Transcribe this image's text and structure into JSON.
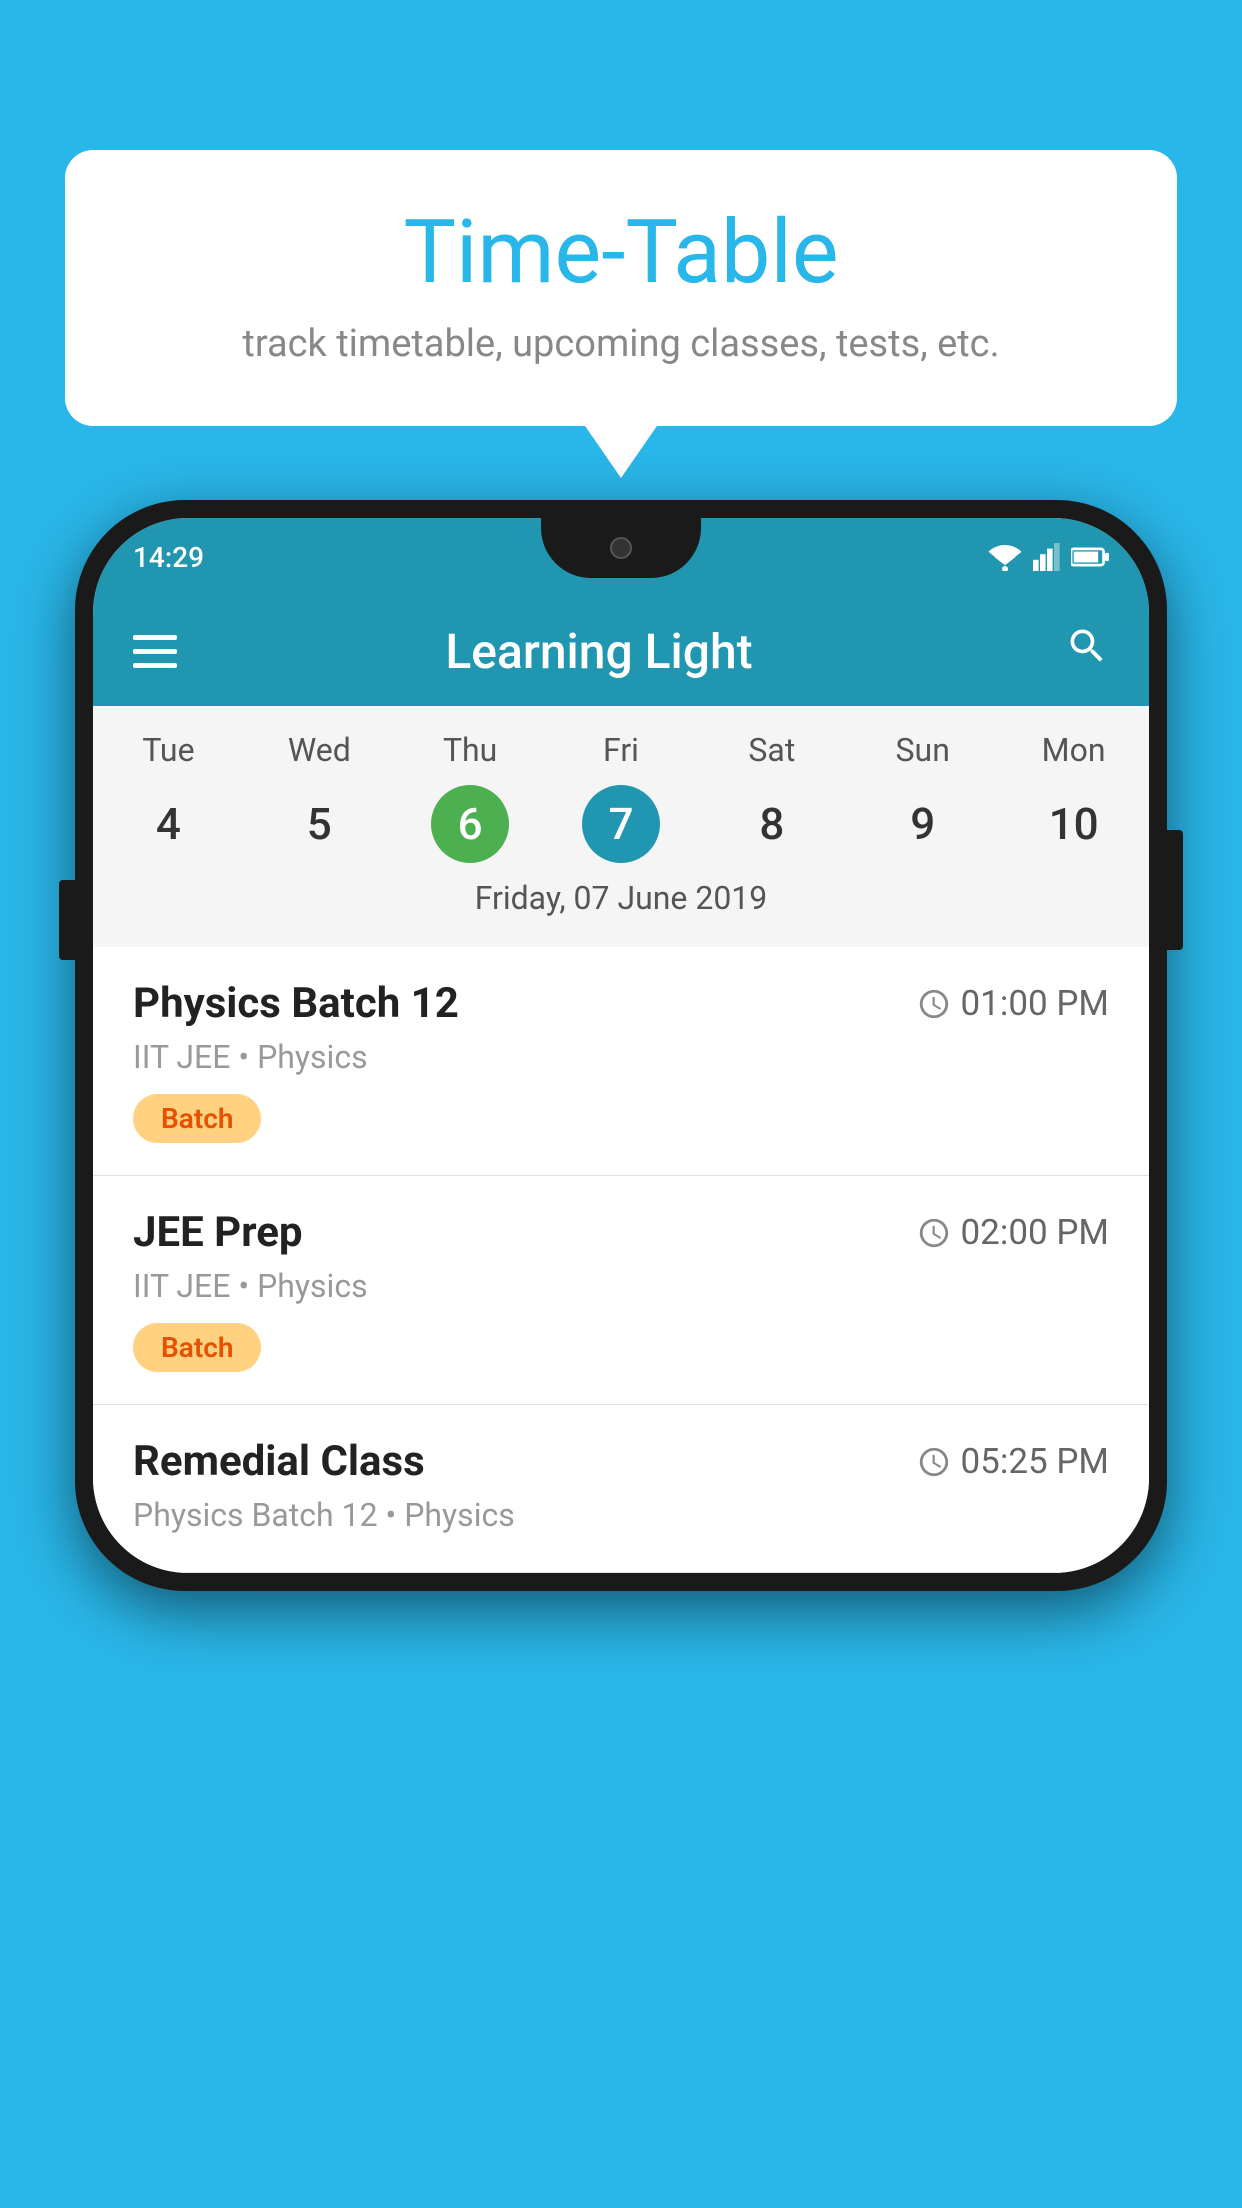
{
  "background_color": "#29b6e8",
  "bubble": {
    "title": "Time-Table",
    "subtitle": "track timetable, upcoming classes, tests, etc."
  },
  "status_bar": {
    "time": "14:29",
    "icons": [
      "wifi",
      "signal",
      "battery"
    ]
  },
  "app_bar": {
    "title": "Learning Light",
    "hamburger_label": "menu",
    "search_label": "search"
  },
  "calendar": {
    "days": [
      "Tue",
      "Wed",
      "Thu",
      "Fri",
      "Sat",
      "Sun",
      "Mon"
    ],
    "dates": [
      "4",
      "5",
      "6",
      "7",
      "8",
      "9",
      "10"
    ],
    "today_index": 2,
    "selected_index": 3,
    "selected_date_label": "Friday, 07 June 2019"
  },
  "schedule": [
    {
      "title": "Physics Batch 12",
      "time": "01:00 PM",
      "subject": "IIT JEE • Physics",
      "badge": "Batch"
    },
    {
      "title": "JEE Prep",
      "time": "02:00 PM",
      "subject": "IIT JEE • Physics",
      "badge": "Batch"
    },
    {
      "title": "Remedial Class",
      "time": "05:25 PM",
      "subject": "Physics Batch 12 • Physics",
      "badge": null
    }
  ]
}
